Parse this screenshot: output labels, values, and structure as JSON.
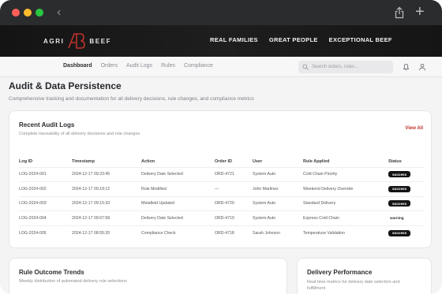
{
  "chrome": {
    "back": "‹",
    "plus": "+"
  },
  "brand": {
    "logo_left": "AGRI",
    "logo_right": "BEEF",
    "nav": [
      "REAL FAMILIES",
      "GREAT PEOPLE",
      "EXCEPTIONAL BEEF"
    ]
  },
  "nav": {
    "tabs": [
      "Dashboard",
      "Orders",
      "Audit Logs",
      "Rules",
      "Compliance"
    ],
    "active_tab": 0,
    "search_placeholder": "Search orders, rules..."
  },
  "page": {
    "title": "Audit & Data Persistence",
    "subtitle": "Comprehensive tracking and documentation for all delivery decisions, rule changes, and compliance metrics"
  },
  "audit": {
    "title": "Recent Audit Logs",
    "subtitle": "Complete traceability of all delivery decisions and rule changes",
    "view_all": "View All",
    "columns": [
      "Log ID",
      "Timestamp",
      "Action",
      "Order ID",
      "User",
      "Rule Applied",
      "Status"
    ],
    "rows": [
      {
        "log_id": "LOG-2024-001",
        "timestamp": "2024-12-17 09:23:45",
        "action": "Delivery Date Selected",
        "order_id": "ORD-4721",
        "user": "System Auto",
        "rule": "Cold Chain Priority",
        "status": "success",
        "status_style": "dark"
      },
      {
        "log_id": "LOG-2024-002",
        "timestamp": "2024-12-17 09:18:12",
        "action": "Rule Modified",
        "order_id": "—",
        "user": "John Martinez",
        "rule": "Weekend Delivery Override",
        "status": "success",
        "status_style": "dark"
      },
      {
        "log_id": "LOG-2024-003",
        "timestamp": "2024-12-17 09:15:33",
        "action": "Metafield Updated",
        "order_id": "ORD-4720",
        "user": "System Auto",
        "rule": "Standard Delivery",
        "status": "success",
        "status_style": "dark"
      },
      {
        "log_id": "LOG-2024-004",
        "timestamp": "2024-12-17 09:07:58",
        "action": "Delivery Date Selected",
        "order_id": "ORD-4719",
        "user": "System Auto",
        "rule": "Express Cold Chain",
        "status": "warning",
        "status_style": "plain"
      },
      {
        "log_id": "LOG-2024-005",
        "timestamp": "2024-12-17 08:55:20",
        "action": "Compliance Check",
        "order_id": "ORD-4718",
        "user": "Sarah Johnson",
        "rule": "Temperature Validation",
        "status": "success",
        "status_style": "dark"
      }
    ]
  },
  "trends": {
    "title": "Rule Outcome Trends",
    "subtitle": "Weekly distribution of automated delivery rule selections"
  },
  "performance": {
    "title": "Delivery Performance",
    "subtitle": "Real-time metrics for delivery date selection and fulfillment"
  },
  "colors": {
    "accent": "#c0322b",
    "brand_bar": "#1a1a1a",
    "badge": "#141416"
  },
  "icons": {
    "back": "chevron-left-icon",
    "share": "share-icon",
    "new_tab": "plus-icon",
    "search": "search-icon",
    "notifications": "bell-icon",
    "account": "user-icon",
    "logo": "ab-logo-mark"
  }
}
